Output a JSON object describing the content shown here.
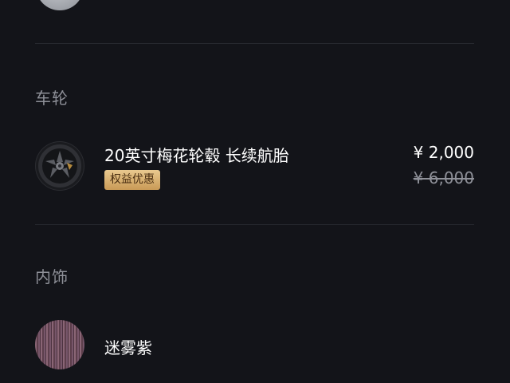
{
  "sections": [
    {
      "title": "车轮",
      "option": {
        "name": "20英寸梅花轮毂 长续航胎",
        "badge": "权益优惠",
        "price": "¥ 2,000",
        "original_price": "¥ 6,000",
        "icon": "wheel-icon"
      }
    },
    {
      "title": "内饰",
      "option": {
        "name": "迷雾紫",
        "icon": "interior-swatch"
      }
    }
  ],
  "colors": {
    "background": "#131419",
    "divider": "#26282e",
    "section_title": "#8e9098",
    "badge_bg": "#d4a865",
    "badge_text": "#4b2f12"
  }
}
